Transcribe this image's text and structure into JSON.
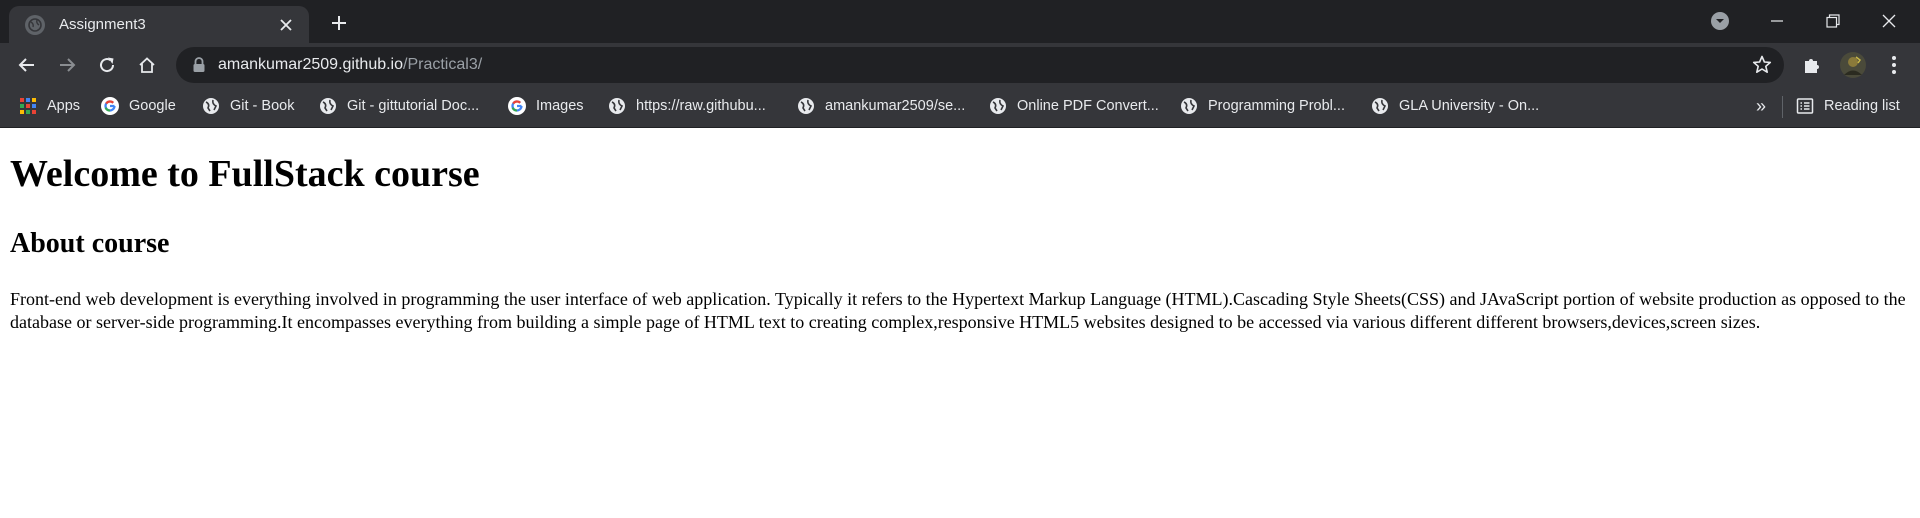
{
  "tab": {
    "title": "Assignment3"
  },
  "address_bar": {
    "host": "amankumar2509.github.io",
    "path": "/Practical3/"
  },
  "bookmarks": [
    {
      "label": "Apps",
      "icon": "apps-grid-icon"
    },
    {
      "label": "Google",
      "icon": "google-icon"
    },
    {
      "label": "Git - Book",
      "icon": "globe-icon"
    },
    {
      "label": "Git - gittutorial Doc...",
      "icon": "globe-icon"
    },
    {
      "label": "Images",
      "icon": "google-icon"
    },
    {
      "label": "https://raw.githubu...",
      "icon": "globe-icon"
    },
    {
      "label": "amankumar2509/se...",
      "icon": "globe-icon"
    },
    {
      "label": "Online PDF Convert...",
      "icon": "globe-icon"
    },
    {
      "label": "Programming Probl...",
      "icon": "globe-icon"
    },
    {
      "label": "GLA University - On...",
      "icon": "globe-icon"
    }
  ],
  "more_bookmarks_label": "»",
  "reading_list_label": "Reading list",
  "page": {
    "heading": "Welcome to FullStack course",
    "subheading": "About course",
    "paragraph": "Front-end web development is everything involved in programming the user interface of web application. Typically it refers to the Hypertext Markup Language (HTML).Cascading Style Sheets(CSS) and JAvaScript portion of website production as opposed to the database or server-side programming.It encompasses everything from building a simple page of HTML text to creating complex,responsive HTML5 websites designed to be accessed via various different different browsers,devices,screen sizes."
  },
  "colors": {
    "tab_strip": "#202124",
    "toolbar": "#35363a",
    "omnibox": "#202124",
    "text_light": "#e8eaed",
    "text_dim": "#9aa0a6",
    "page_background": "#ffffff"
  }
}
